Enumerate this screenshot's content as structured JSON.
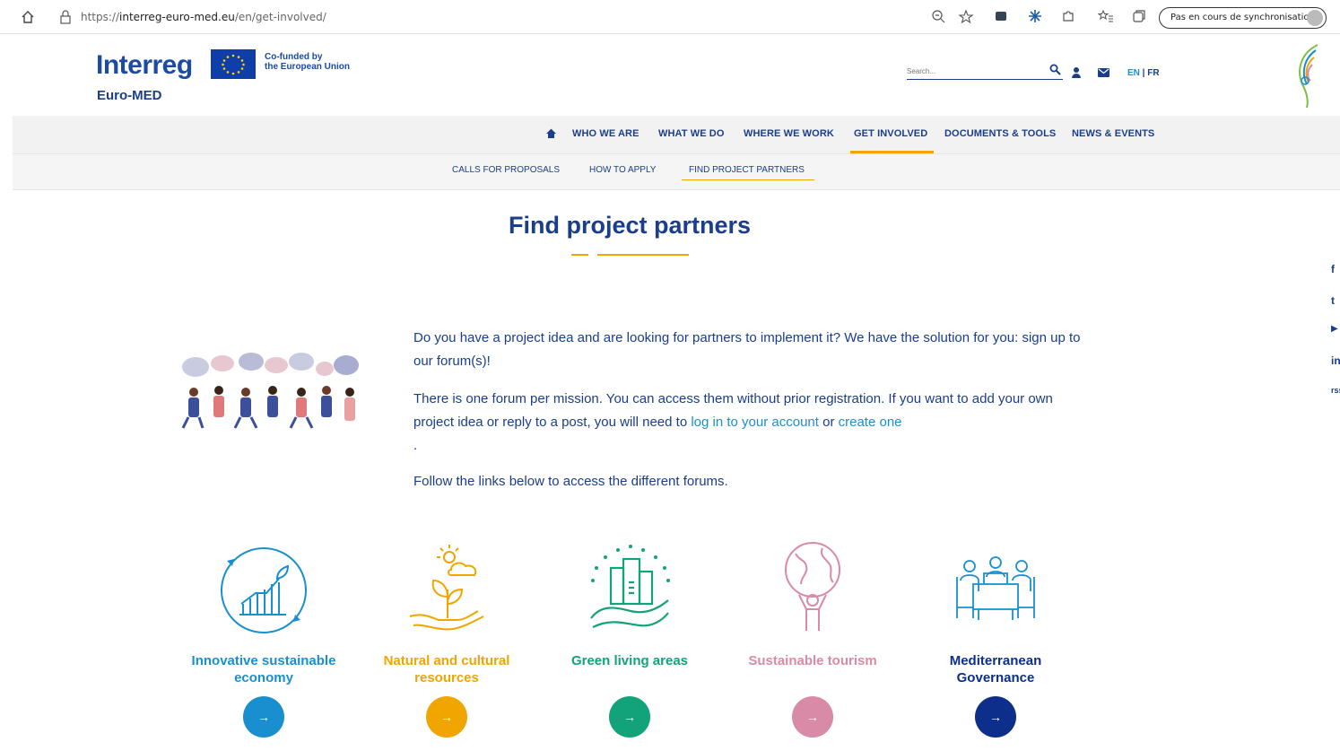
{
  "browser": {
    "url_prefix": "https://",
    "url_domain": "interreg-euro-med.eu",
    "url_path": "/en/get-involved/",
    "sync_label": "Pas en cours de synchronisation"
  },
  "header": {
    "logo": "Interreg",
    "cofunded_line1": "Co-funded by",
    "cofunded_line2": "the European Union",
    "subbrand": "Euro-MED",
    "search_placeholder": "Search...",
    "lang_en": "EN",
    "lang_sep": " | ",
    "lang_fr": "FR"
  },
  "nav": {
    "items": [
      "WHO WE ARE",
      "WHAT WE DO",
      "WHERE WE WORK",
      "GET INVOLVED",
      "DOCUMENTS & TOOLS",
      "NEWS & EVENTS"
    ],
    "active": "GET INVOLVED"
  },
  "subnav": {
    "items": [
      "CALLS FOR PROPOSALS",
      "HOW TO APPLY",
      "FIND PROJECT PARTNERS"
    ],
    "active": "FIND PROJECT PARTNERS"
  },
  "main": {
    "title": "Find project partners",
    "p1": "Do you have a project idea and are looking for partners to implement it? We have the solution for you: sign up to our forum(s)!",
    "p2_a": "There is one forum per mission. You can access them without prior registration. If you want to add your own project idea or reply to a post, you will need to ",
    "p2_link1": "log in to your account",
    "p2_b": " or ",
    "p2_link2": "create one",
    "p2_c": ".",
    "p3": "Follow the links below to access the different forums."
  },
  "missions": [
    {
      "label_l1": "Innovative sustainable",
      "label_l2": "economy",
      "color": "#1a8fd0",
      "arrow": "→"
    },
    {
      "label_l1": "Natural and cultural",
      "label_l2": "resources",
      "color": "#f0a500",
      "arrow": "→"
    },
    {
      "label_l1": "Green living areas",
      "label_l2": "",
      "color": "#13a37a",
      "arrow": "→"
    },
    {
      "label_l1": "Sustainable tourism",
      "label_l2": "",
      "color": "#d98aa6",
      "arrow": "→"
    },
    {
      "label_l1": "Mediterranean",
      "label_l2": "Governance",
      "color": "#0d2e8a",
      "arrow": "→"
    }
  ],
  "social": [
    "f",
    "t",
    "▶",
    "in",
    "rss"
  ],
  "colors": {
    "brand_blue": "#1a3e8c",
    "accent_orange": "#f0a500",
    "link_blue": "#1a8fd0"
  }
}
